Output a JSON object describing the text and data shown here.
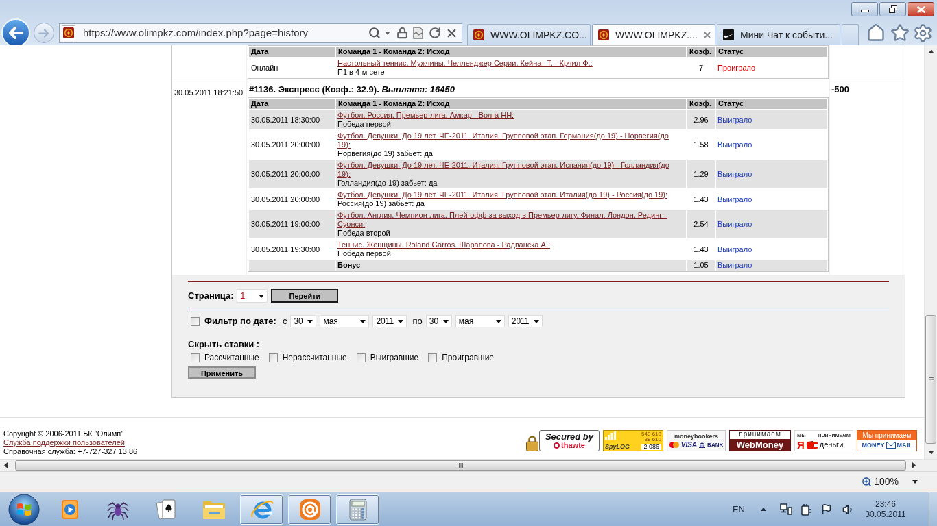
{
  "browser": {
    "url": "https://www.olimpkz.com/index.php?page=history",
    "tabs": [
      {
        "title": "WWW.OLIMPKZ.CO...",
        "selected": false
      },
      {
        "title": "WWW.OLIMPKZ....",
        "selected": true
      },
      {
        "title": "Мини Чат к событи...",
        "selected": false
      }
    ]
  },
  "bets": [
    {
      "columns": [
        "Дата",
        "Команда 1 - Команда 2: Исход",
        "Коэф.",
        "Статус"
      ],
      "rows": [
        {
          "kind": "event",
          "shaded": false,
          "date": "Онлайн",
          "event": "Настольный теннис. Мужчины. Челленджер Серии. Кейнат Т. - Крчил Ф.:",
          "outcome": "П1 в 4-м сете",
          "coef": "7",
          "status": "Проиграло",
          "won": false
        }
      ]
    },
    {
      "date": "30.05.2011 18:21:50",
      "title": "#1136. Экспресс (Коэф.: 32.9). *Выплата: 16450*",
      "amount": "-500",
      "columns": [
        "Дата",
        "Команда 1 - Команда 2: Исход",
        "Коэф.",
        "Статус"
      ],
      "rows": [
        {
          "kind": "event",
          "shaded": true,
          "date": "30.05.2011 18:30:00",
          "event": "Футбол. Россия. Премьер-лига. Амкар - Волга НН:",
          "outcome": "Победа первой",
          "coef": "2.96",
          "status": "Выиграло",
          "won": true
        },
        {
          "kind": "event",
          "shaded": false,
          "date": "30.05.2011 20:00:00",
          "event": "Футбол. Девушки. До 19 лет. ЧЕ-2011. Италия. Групповой этап. Германия(до 19) - Норвегия(до 19):",
          "outcome": "Норвегия(до 19) забьет: да",
          "coef": "1.58",
          "status": "Выиграло",
          "won": true
        },
        {
          "kind": "event",
          "shaded": true,
          "date": "30.05.2011 20:00:00",
          "event": "Футбол. Девушки. До 19 лет. ЧЕ-2011. Италия. Групповой этап. Испания(до 19) - Голландия(до 19):",
          "outcome": "Голландия(до 19) забьет: да",
          "coef": "1.29",
          "status": "Выиграло",
          "won": true
        },
        {
          "kind": "event",
          "shaded": false,
          "date": "30.05.2011 20:00:00",
          "event": "Футбол. Девушки. До 19 лет. ЧЕ-2011. Италия. Групповой этап. Италия(до 19) - Россия(до 19):",
          "outcome": "Россия(до 19) забьет: да",
          "coef": "1.43",
          "status": "Выиграло",
          "won": true
        },
        {
          "kind": "event",
          "shaded": true,
          "date": "30.05.2011 19:00:00",
          "event": "Футбол. Англия. Чемпион-лига. Плей-офф за выход в Премьер-лигу. Финал. Лондон. Рединг - Суонси:",
          "outcome": "Победа второй",
          "coef": "2.54",
          "status": "Выиграло",
          "won": true
        },
        {
          "kind": "event",
          "shaded": false,
          "date": "30.05.2011 19:30:00",
          "event": "Теннис. Женщины. Roland Garros. Шарапова - Радванска А.:",
          "outcome": "Победа первой",
          "coef": "1.43",
          "status": "Выиграло",
          "won": true
        },
        {
          "kind": "bonus",
          "shaded": true,
          "label": "Бонус",
          "coef": "1.05",
          "status": "Выиграло",
          "won": true
        }
      ]
    }
  ],
  "pager": {
    "label": "Страница:",
    "value": "1",
    "button": {
      "label": "Перейти",
      "focused": true
    }
  },
  "date_filter": {
    "checked": false,
    "label": "Фильтр по дате:",
    "from_label": "с",
    "from": [
      "30",
      "мая",
      "2011"
    ],
    "to_label": "по",
    "to": [
      "30",
      "мая",
      "2011"
    ]
  },
  "hide_bets": {
    "label": "Скрыть ставки :",
    "options": [
      {
        "label": "Рассчитанные",
        "checked": false
      },
      {
        "label": "Нерассчитанные",
        "checked": false
      },
      {
        "label": "Выигравшие",
        "checked": false
      },
      {
        "label": "Проигравшие",
        "checked": false
      }
    ],
    "button": {
      "label": "Применить",
      "focused": false
    }
  },
  "footer": {
    "copyright": "Copyright © 2006-2011 БК \"Олимп\"",
    "support_link": "Служба поддержки пользователей",
    "phone": "Справочная служба: +7-727-327 13 86",
    "badges": [
      {
        "kind": "thawte",
        "lines": [
          "Secured by",
          "thawte"
        ]
      },
      {
        "kind": "counter",
        "lines": [
          "543 610",
          "38 610",
          "SpyLOG",
          "2 086"
        ]
      },
      {
        "kind": "moneybookers",
        "lines": [
          "moneybookers",
          "VISA",
          "BANK"
        ]
      },
      {
        "kind": "webmoney",
        "lines": [
          "принимаем",
          "WebMoney"
        ]
      },
      {
        "kind": "yandex",
        "lines": [
          "мы",
          "принимаем",
          "Я",
          "деньги"
        ]
      },
      {
        "kind": "moneymail",
        "lines": [
          "Мы принимаем",
          "MONEY",
          "MAIL"
        ]
      }
    ]
  },
  "status_bar": {
    "zoom": "100%"
  },
  "taskbar": {
    "apps": [
      {
        "running": false
      },
      {
        "running": false
      },
      {
        "running": false
      },
      {
        "running": false
      },
      {
        "running": true
      },
      {
        "running": true
      },
      {
        "running": true
      }
    ],
    "language": "EN",
    "time": "23:46",
    "date": "30.05.2011"
  }
}
